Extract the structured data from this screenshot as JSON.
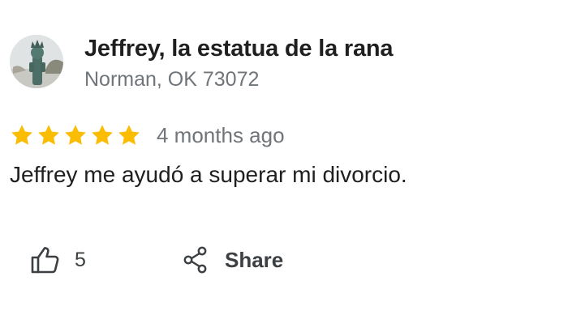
{
  "reviewer": {
    "name": "Jeffrey, la estatua de la rana",
    "location": "Norman, OK 73072",
    "avatar_icon": "frog-statue-photo"
  },
  "review": {
    "rating": 5,
    "max_rating": 5,
    "time_ago": "4 months ago",
    "text": "Jeffrey me ayudó a superar mi divorcio."
  },
  "actions": {
    "like_count": "5",
    "share_label": "Share"
  },
  "colors": {
    "star": "#fbbc04",
    "secondary_text": "#70757a"
  }
}
